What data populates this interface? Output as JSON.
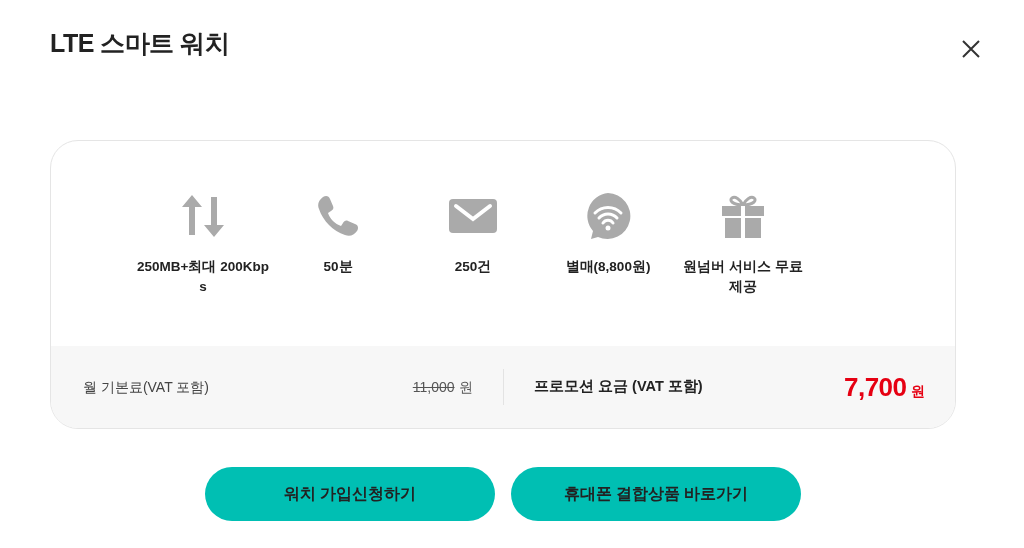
{
  "title": "LTE 스마트 워치",
  "features": [
    {
      "kind": "data",
      "label": "250MB+최대 200Kbps"
    },
    {
      "kind": "call",
      "label": "50분"
    },
    {
      "kind": "message",
      "label": "250건"
    },
    {
      "kind": "wifi",
      "label": "별매(8,800원)"
    },
    {
      "kind": "gift",
      "label": "원넘버 서비스 무료 제공"
    }
  ],
  "price": {
    "base_label": "월 기본료(VAT 포함)",
    "base_amount": "11,000",
    "base_unit": "원",
    "promo_label": "프로모션 요금 (VAT 포함)",
    "promo_amount": "7,700",
    "promo_unit": "원"
  },
  "buttons": [
    "워치 가입신청하기",
    "휴대폰 결합상품 바로가기"
  ]
}
